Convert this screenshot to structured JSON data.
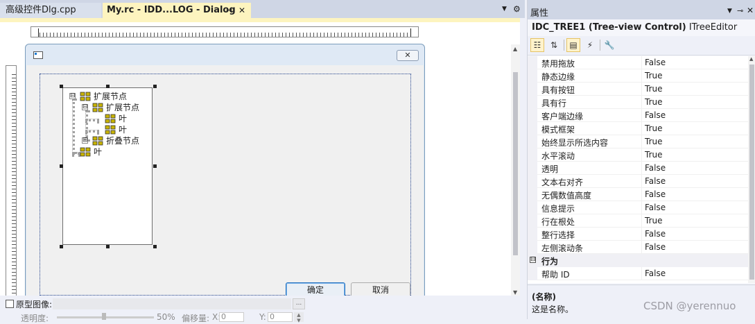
{
  "tabs": {
    "tab1": "高级控件Dlg.cpp",
    "tab2": "My.rc - IDD...LOG - Dialog",
    "pin_glyph": "⊸",
    "close_glyph": "✕"
  },
  "dialog": {
    "close_glyph": "✕",
    "ok_label": "确定",
    "cancel_label": "取消"
  },
  "tree": {
    "nodes": [
      {
        "label": "扩展节点",
        "expander": "⊟"
      },
      {
        "label": "扩展节点",
        "expander": "⊟"
      },
      {
        "label": "叶"
      },
      {
        "label": "叶"
      },
      {
        "label": "折叠节点",
        "expander": "⊞"
      },
      {
        "label": "叶"
      }
    ],
    "icon": "tree-node-icon",
    "icon_color": "#c9b400"
  },
  "bottom": {
    "proto_label": "原型图像:",
    "browse": "...",
    "opacity_label": "透明度:",
    "opacity_value": "50%",
    "opacity_level": 0.5,
    "offset_label": "偏移量:",
    "x_label": "X:",
    "x_value": "0",
    "y_label": "Y:",
    "y_value": "0"
  },
  "properties": {
    "title": "属性",
    "object_id": "IDC_TREE1 (Tree-view Control)",
    "object_editor": "ITreeEditor",
    "rows": [
      {
        "name": "禁用拖放",
        "value": "False"
      },
      {
        "name": "静态边缘",
        "value": "True"
      },
      {
        "name": "具有按钮",
        "value": "True"
      },
      {
        "name": "具有行",
        "value": "True"
      },
      {
        "name": "客户端边缘",
        "value": "False"
      },
      {
        "name": "模式框架",
        "value": "True"
      },
      {
        "name": "始终显示所选内容",
        "value": "True"
      },
      {
        "name": "水平滚动",
        "value": "True"
      },
      {
        "name": "透明",
        "value": "False"
      },
      {
        "name": "文本右对齐",
        "value": "False"
      },
      {
        "name": "无偶数值高度",
        "value": "False"
      },
      {
        "name": "信息提示",
        "value": "False"
      },
      {
        "name": "行在根处",
        "value": "True"
      },
      {
        "name": "整行选择",
        "value": "False"
      },
      {
        "name": "左侧滚动条",
        "value": "False"
      }
    ],
    "category": {
      "label": "行为",
      "collapse": "⊟"
    },
    "rows2": [
      {
        "name": "帮助 ID",
        "value": "False"
      }
    ],
    "desc_name": "(名称)",
    "desc_text": "这是名称。"
  },
  "watermark": "CSDN @yerennuo"
}
